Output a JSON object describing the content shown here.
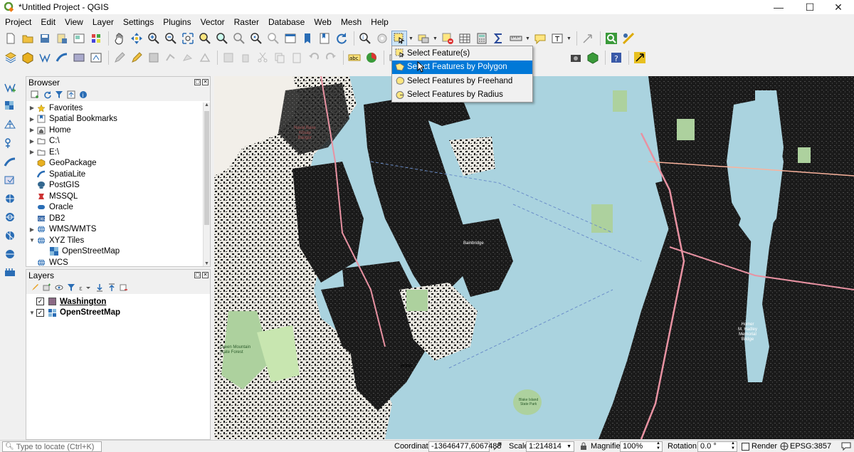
{
  "window": {
    "title": "*Untitled Project - QGIS",
    "minimize": "—",
    "maximize": "☐",
    "close": "✕"
  },
  "menu": [
    "Project",
    "Edit",
    "View",
    "Layer",
    "Settings",
    "Plugins",
    "Vector",
    "Raster",
    "Database",
    "Web",
    "Mesh",
    "Help"
  ],
  "browser": {
    "title": "Browser",
    "items": [
      {
        "label": "Favorites",
        "icon": "star-icon",
        "expand": true
      },
      {
        "label": "Spatial Bookmarks",
        "icon": "bookmark-icon",
        "expand": true
      },
      {
        "label": "Home",
        "icon": "home-folder-icon",
        "expand": true
      },
      {
        "label": "C:\\",
        "icon": "drive-icon",
        "expand": true
      },
      {
        "label": "E:\\",
        "icon": "drive-icon",
        "expand": true
      },
      {
        "label": "GeoPackage",
        "icon": "geopackage-icon",
        "expand": false
      },
      {
        "label": "SpatiaLite",
        "icon": "spatialite-icon",
        "expand": false
      },
      {
        "label": "PostGIS",
        "icon": "postgis-icon",
        "expand": false
      },
      {
        "label": "MSSQL",
        "icon": "mssql-icon",
        "expand": false
      },
      {
        "label": "Oracle",
        "icon": "oracle-icon",
        "expand": false
      },
      {
        "label": "DB2",
        "icon": "db2-icon",
        "expand": false
      },
      {
        "label": "WMS/WMTS",
        "icon": "globe-icon",
        "expand": true
      },
      {
        "label": "XYZ Tiles",
        "icon": "globe-icon",
        "expand": "open"
      },
      {
        "label": "OpenStreetMap",
        "icon": "tiles-icon",
        "child": true
      },
      {
        "label": "WCS",
        "icon": "globe-icon",
        "expand": false
      }
    ]
  },
  "layers": {
    "title": "Layers",
    "items": [
      {
        "label": "Washington",
        "checked": true,
        "color": "#8b6a85"
      },
      {
        "label": "OpenStreetMap",
        "checked": true
      }
    ]
  },
  "select_menu": {
    "items": [
      "Select Feature(s)",
      "Select Features by Polygon",
      "Select Features by Freehand",
      "Select Features by Radius"
    ],
    "selected_index": 1,
    "highlight_color": "#0078d7"
  },
  "status": {
    "locate_placeholder": "Type to locate (Ctrl+K)",
    "coordinate_label": "Coordinate",
    "coordinate_value": "-13646477,6067488",
    "scale_label": "Scale",
    "scale_value": "1:214814",
    "magnifier_label": "Magnifier",
    "magnifier_value": "100%",
    "rotation_label": "Rotation",
    "rotation_value": "0.0 °",
    "render_label": "Render",
    "crs_label": "EPSG:3857"
  },
  "map_labels": {
    "naval_base": "Naval Base\nKitsap\nBangor",
    "green_mountain": "Green Mountain\nState Forest",
    "bainbridge": "Bainbridge",
    "horses_bridge": "Homer\nM. Hadley\nMemorial\nBridge",
    "erton": "erton",
    "blake_island": "Blake Island\nState Park"
  }
}
